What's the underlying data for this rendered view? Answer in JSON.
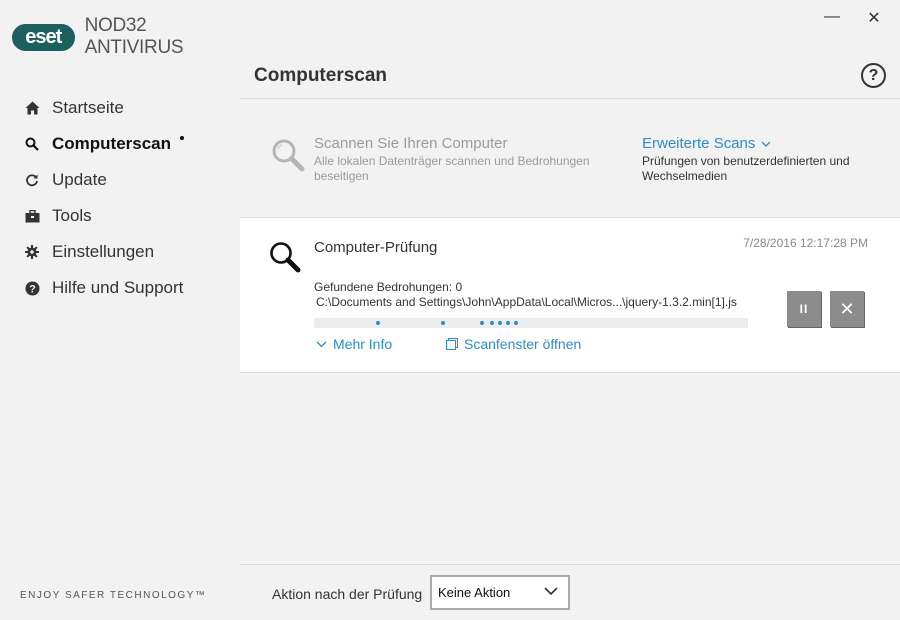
{
  "app": {
    "logo_badge": "eset",
    "product_name": "NOD32 ANTIVIRUS",
    "tagline": "ENJOY SAFER TECHNOLOGY™"
  },
  "window": {
    "minimize": "—",
    "close": "✕"
  },
  "sidebar": {
    "items": [
      {
        "label": "Startseite",
        "icon": "home-icon"
      },
      {
        "label": "Computerscan",
        "icon": "search-icon",
        "active": true
      },
      {
        "label": "Update",
        "icon": "refresh-icon"
      },
      {
        "label": "Tools",
        "icon": "toolbox-icon"
      },
      {
        "label": "Einstellungen",
        "icon": "gear-icon"
      },
      {
        "label": "Hilfe und Support",
        "icon": "help-circle-icon"
      }
    ]
  },
  "main": {
    "title": "Computerscan",
    "help": "?",
    "scan_option": {
      "title": "Scannen Sie Ihren Computer",
      "description": "Alle lokalen Datenträger scannen und Bedrohungen beseitigen"
    },
    "advanced_option": {
      "title": "Erweiterte Scans",
      "description": "Prüfungen von benutzerdefinierten und Wechselmedien"
    },
    "scan_card": {
      "title": "Computer-Prüfung",
      "timestamp": "7/28/2016 12:17:28 PM",
      "threats": "Gefundene Bedrohungen: 0",
      "current_path": "C:\\Documents and Settings\\John\\AppData\\Local\\Micros...\\jquery-1.3.2.min[1].js",
      "pause_label": "II",
      "stop_label": "✕",
      "more_info": "Mehr Info",
      "open_window": "Scanfenster öffnen"
    },
    "footer": {
      "label": "Aktion nach der Prüfung",
      "selected": "Keine Aktion"
    }
  },
  "colors": {
    "accent": "#2b8dc9",
    "brand": "#1e5f5f",
    "button_gray": "#8c8c8c",
    "background": "#f2f2f2"
  }
}
